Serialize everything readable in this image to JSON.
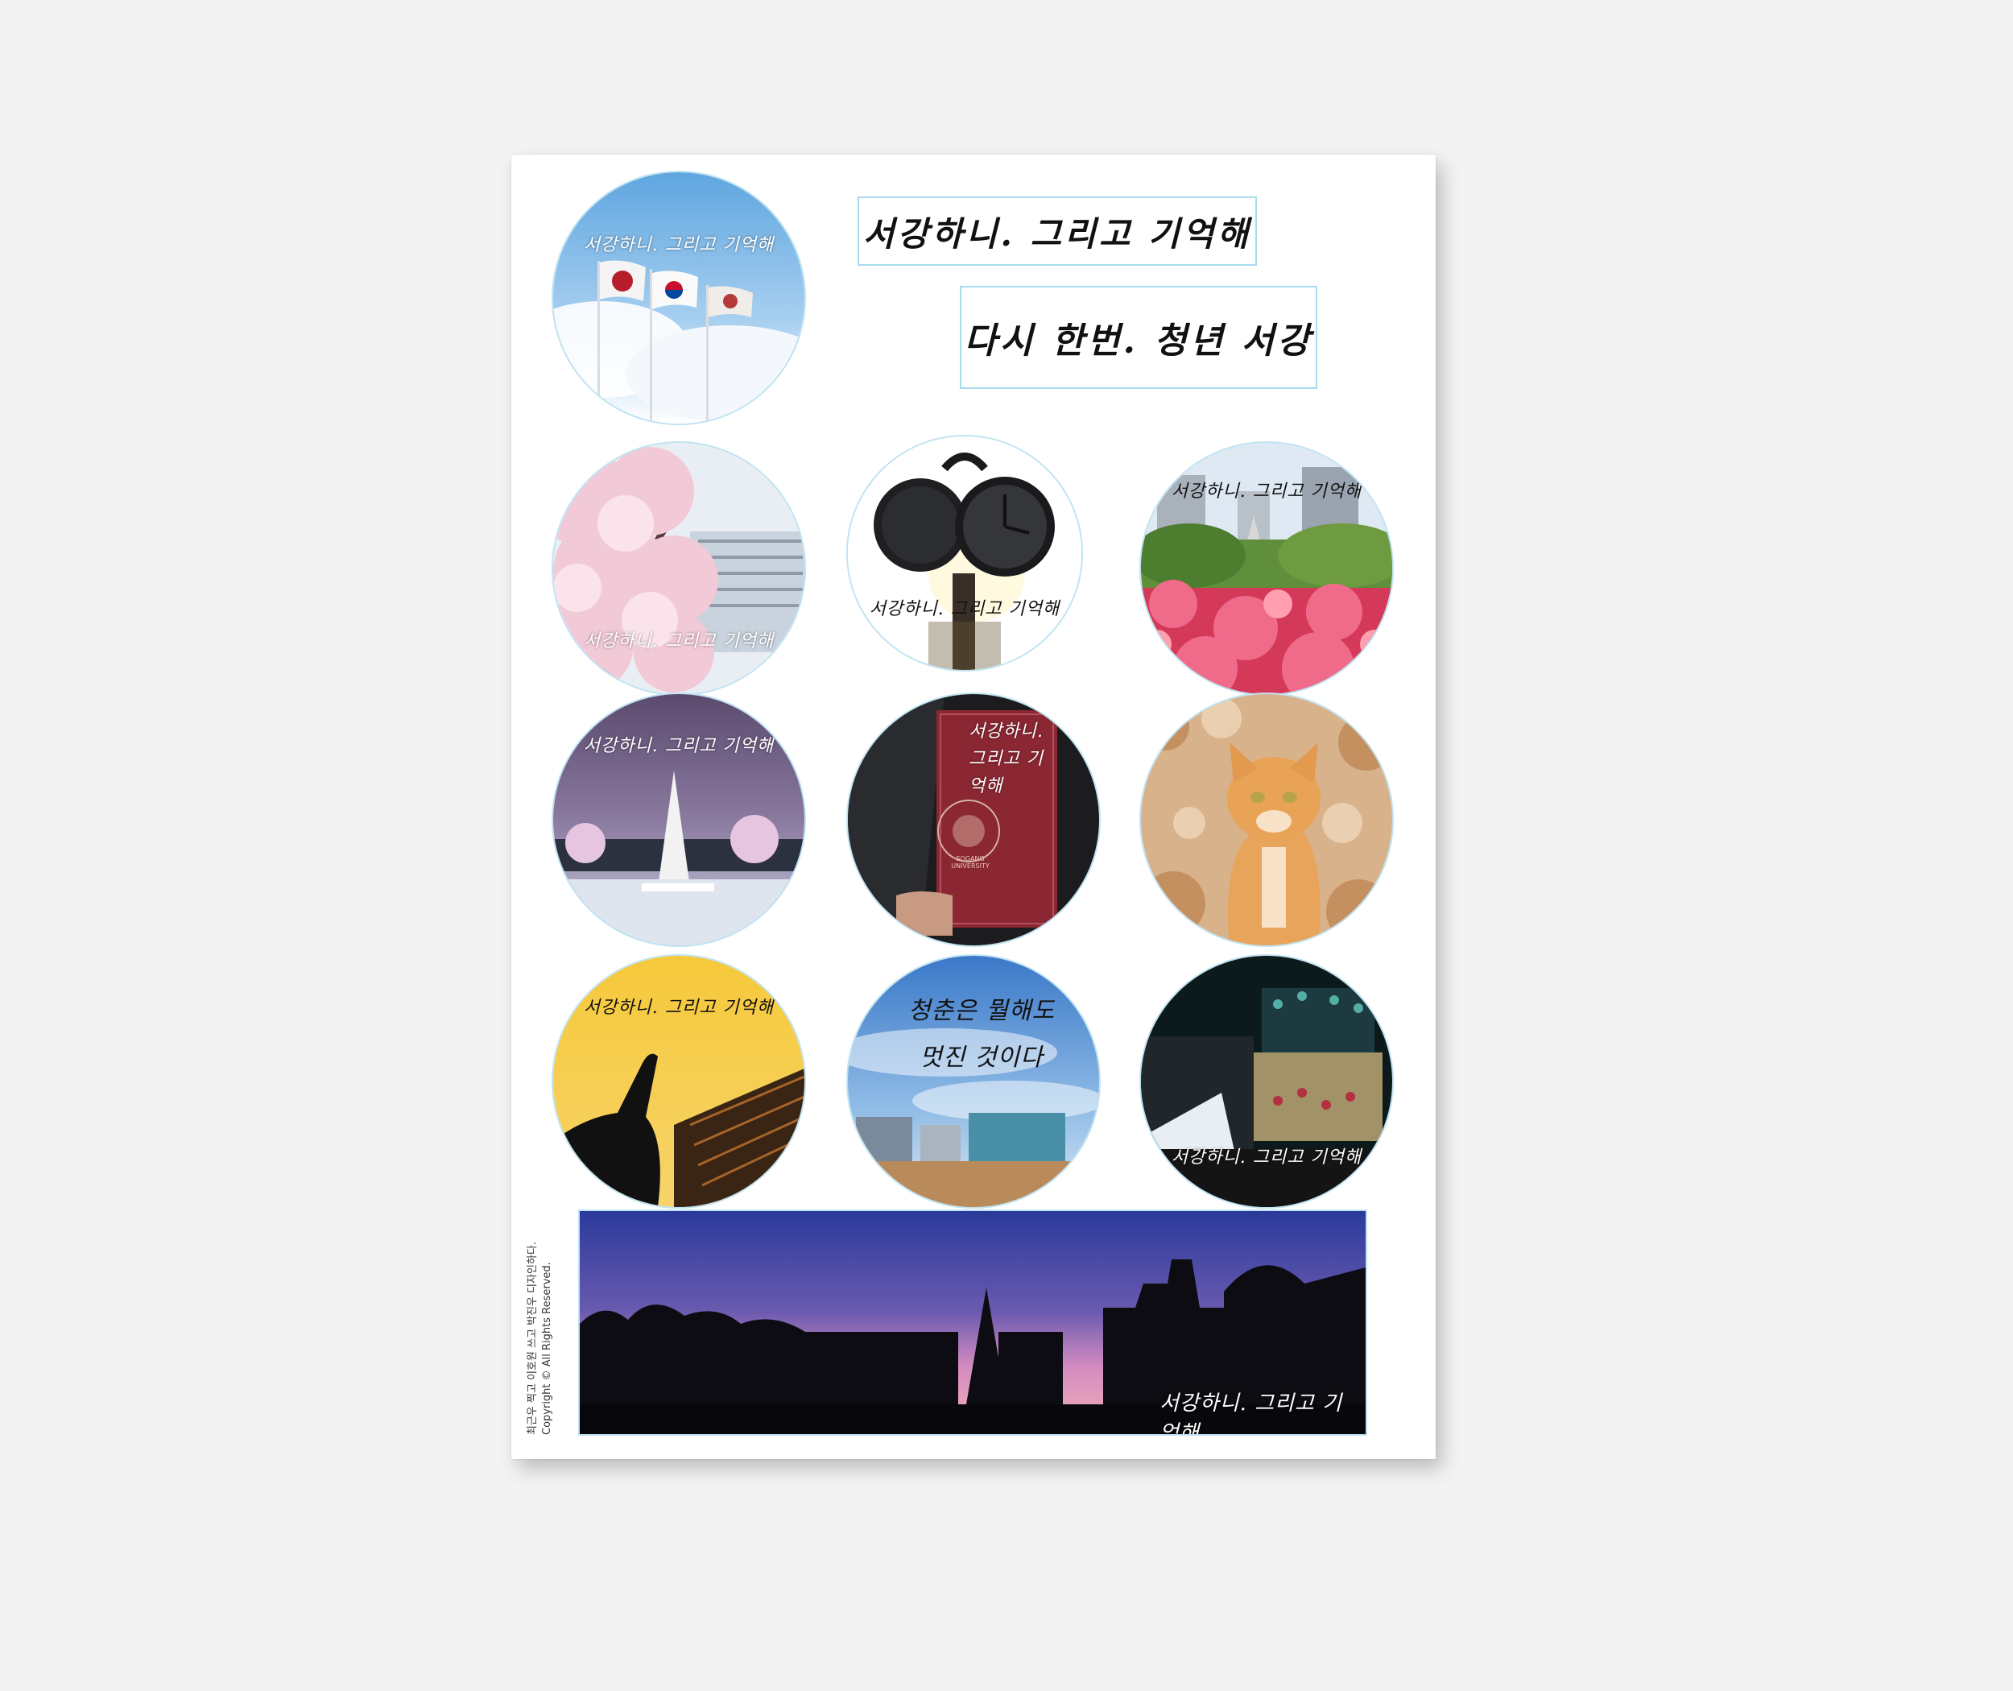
{
  "sheet": {
    "caption": "서강하니, 그리고 기억해",
    "labels": [
      "서강하니. 그리고 기억해",
      "다시 한번. 청년 서강"
    ],
    "stickers": [
      {
        "id": "flags",
        "caption": "서강하니. 그리고 기억해"
      },
      {
        "id": "cherry",
        "caption": "서강하니. 그리고 기억해"
      },
      {
        "id": "clock",
        "caption": "서강하니. 그리고 기억해"
      },
      {
        "id": "garden",
        "caption": "서강하니. 그리고 기억해"
      },
      {
        "id": "night-tower",
        "caption": "서강하니. 그리고 기억해"
      },
      {
        "id": "diploma",
        "caption": "서강하니. 그리고 기억해"
      },
      {
        "id": "cat",
        "caption": ""
      },
      {
        "id": "silhouette",
        "caption": "서강하니. 그리고 기억해"
      },
      {
        "id": "campus-sky",
        "caption": "청춘은 뭘해도 멋진 것이다"
      },
      {
        "id": "festival",
        "caption": "서강하니. 그리고 기억해"
      }
    ],
    "banner_caption": "서강하니. 그리고 기억해",
    "diploma_seal": "SOGANG UNIVERSITY",
    "copyright_line1": "최근우 찍고 이호원 쓰고 박진우 디자인하다.",
    "copyright_line2": "Copyright © All Rights Reserved."
  },
  "colors": {
    "outline": "#a9dbef",
    "page": "#f3f3f3",
    "sheet": "#ffffff"
  }
}
